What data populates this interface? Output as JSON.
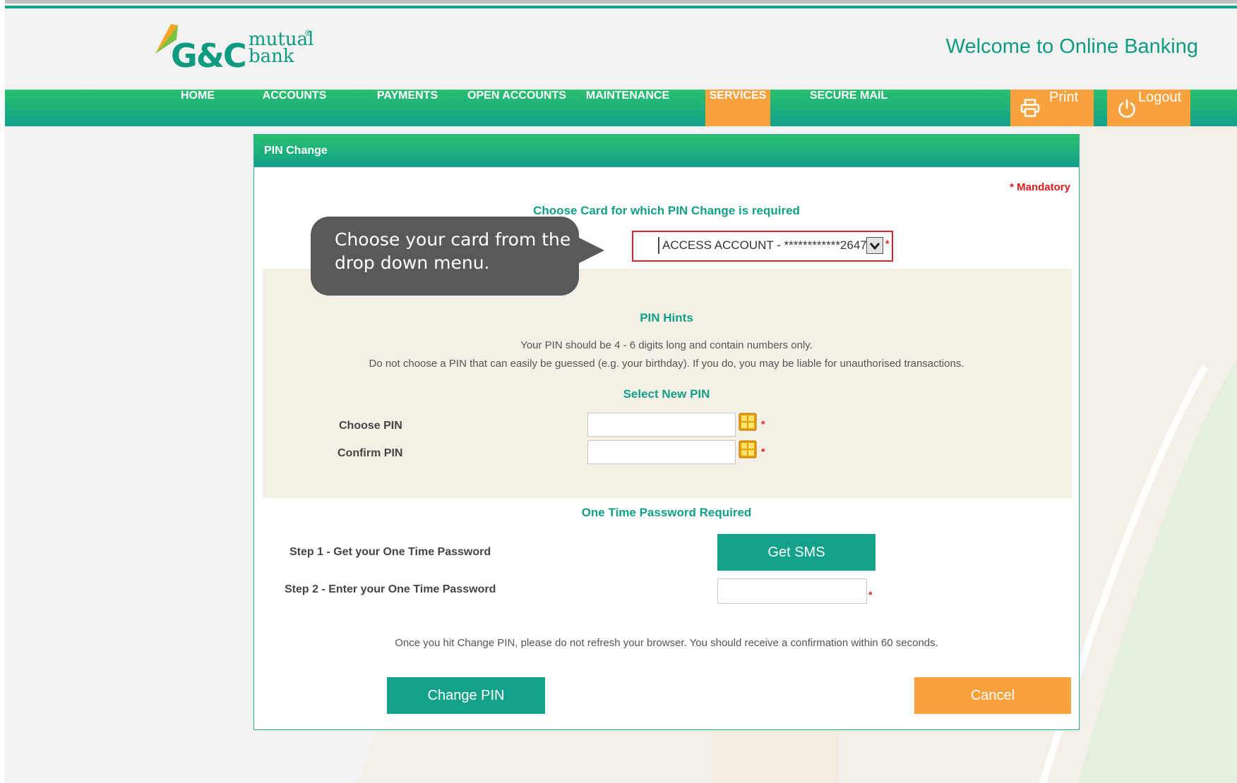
{
  "logo": {
    "primary": "G&C",
    "word1": "mutual",
    "word2": "bank",
    "reg": "®"
  },
  "header": {
    "welcome": "Welcome to Online Banking"
  },
  "nav": {
    "items": [
      "HOME",
      "ACCOUNTS",
      "PAYMENTS",
      "OPEN ACCOUNTS",
      "MAINTENANCE",
      "SERVICES",
      "SECURE MAIL"
    ],
    "active": "SERVICES",
    "print_label": "Print",
    "logout_label": "Logout"
  },
  "panel": {
    "title": "PIN Change",
    "mandatory": "* Mandatory",
    "card_title": "Choose Card for which PIN Change is required",
    "card_selected": "ACCESS ACCOUNT - ************2647",
    "callout": "Choose your card from the drop down menu.",
    "hints_title": "PIN Hints",
    "hint_1": "Your PIN should be 4 - 6 digits long and contain numbers only.",
    "hint_2": "Do not choose a PIN that can easily be guessed (e.g. your birthday). If you do, you may be liable for unauthorised transactions.",
    "select_title": "Select New PIN",
    "choose_pin_label": "Choose PIN",
    "confirm_pin_label": "Confirm PIN",
    "otp_title": "One Time Password Required",
    "step1_label": "Step 1 - Get your One Time Password",
    "step2_label": "Step 2 - Enter your One Time Password",
    "get_sms_label": "Get SMS",
    "notice": "Once you hit Change PIN, please do not refresh your browser. You should receive a confirmation within 60 seconds.",
    "change_pin_label": "Change PIN",
    "cancel_label": "Cancel",
    "required_mark": "*"
  },
  "colors": {
    "brand_green": "#13a18a",
    "accent_orange": "#f7a23c",
    "required_red": "#e01b1b"
  }
}
